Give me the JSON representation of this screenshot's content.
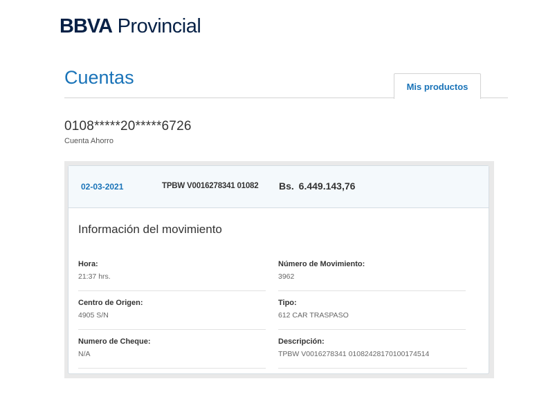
{
  "brand": {
    "bold": "BBVA",
    "light": "Provincial"
  },
  "header": {
    "title": "Cuentas",
    "tab_label": "Mis productos"
  },
  "account": {
    "number": "0108*****20*****6726",
    "type": "Cuenta Ahorro"
  },
  "movement": {
    "date": "02-03-2021",
    "reference": "TPBW V0016278341 01082",
    "amount": "Bs.  6.449.143,76",
    "info_title": "Información del movimiento",
    "fields": [
      {
        "label": "Hora:",
        "value": "21:37 hrs."
      },
      {
        "label": "Número de Movimiento:",
        "value": "3962"
      },
      {
        "label": "Centro de Origen:",
        "value": "4905  S/N"
      },
      {
        "label": "Tipo:",
        "value": "612 CAR TRASPASO"
      },
      {
        "label": "Numero de Cheque:",
        "value": "N/A"
      },
      {
        "label": "Descripción:",
        "value": "TPBW V0016278341 01082428170100174514"
      }
    ]
  },
  "colors": {
    "brand_navy": "#072146",
    "accent_blue": "#1973b8",
    "panel_head_bg": "#f4f9fc"
  }
}
